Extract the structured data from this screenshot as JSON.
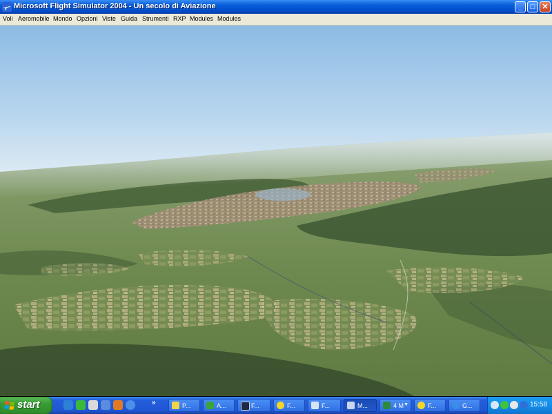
{
  "window": {
    "title": "Microsoft Flight Simulator 2004 - Un secolo di Aviazione",
    "app_icon": "plane-icon",
    "controls": {
      "minimize": "_",
      "maximize": "□",
      "close": "✕"
    }
  },
  "menubar": {
    "items": [
      "Voli",
      "Aeromobile",
      "Mondo",
      "Opzioni",
      "Viste",
      "Guida",
      "Strumenti",
      "RXP",
      "Modules",
      "Modules"
    ]
  },
  "scene": {
    "description_icon": "flight-view",
    "colors": {
      "sky_top": "#8fbde6",
      "sky_horizon": "#dcebf3",
      "ground": "#6f8a52",
      "forest": "#3d5530",
      "town": "#a8927a"
    }
  },
  "taskbar": {
    "start_label": "start",
    "quick_launch": [
      "ie-icon",
      "messenger-icon",
      "media-icon",
      "desktop-icon",
      "firefox-icon",
      "search-icon"
    ],
    "chevron": "»",
    "tasks": [
      {
        "label": "P...",
        "icon": "paint-icon",
        "active": false
      },
      {
        "label": "A...",
        "icon": "app-icon",
        "active": false
      },
      {
        "label": "F...",
        "icon": "window-icon",
        "active": false
      },
      {
        "label": "F...",
        "icon": "sun-icon",
        "active": false
      },
      {
        "label": "F...",
        "icon": "plane-icon",
        "active": false
      },
      {
        "label": "M...",
        "icon": "plane-icon",
        "active": true
      },
      {
        "label": "4 M",
        "icon": "excel-icon",
        "active": false
      },
      {
        "label": "F...",
        "icon": "sun-icon",
        "active": false
      },
      {
        "label": "G...",
        "icon": "globe-icon",
        "active": false
      }
    ],
    "clock": "15:58"
  }
}
